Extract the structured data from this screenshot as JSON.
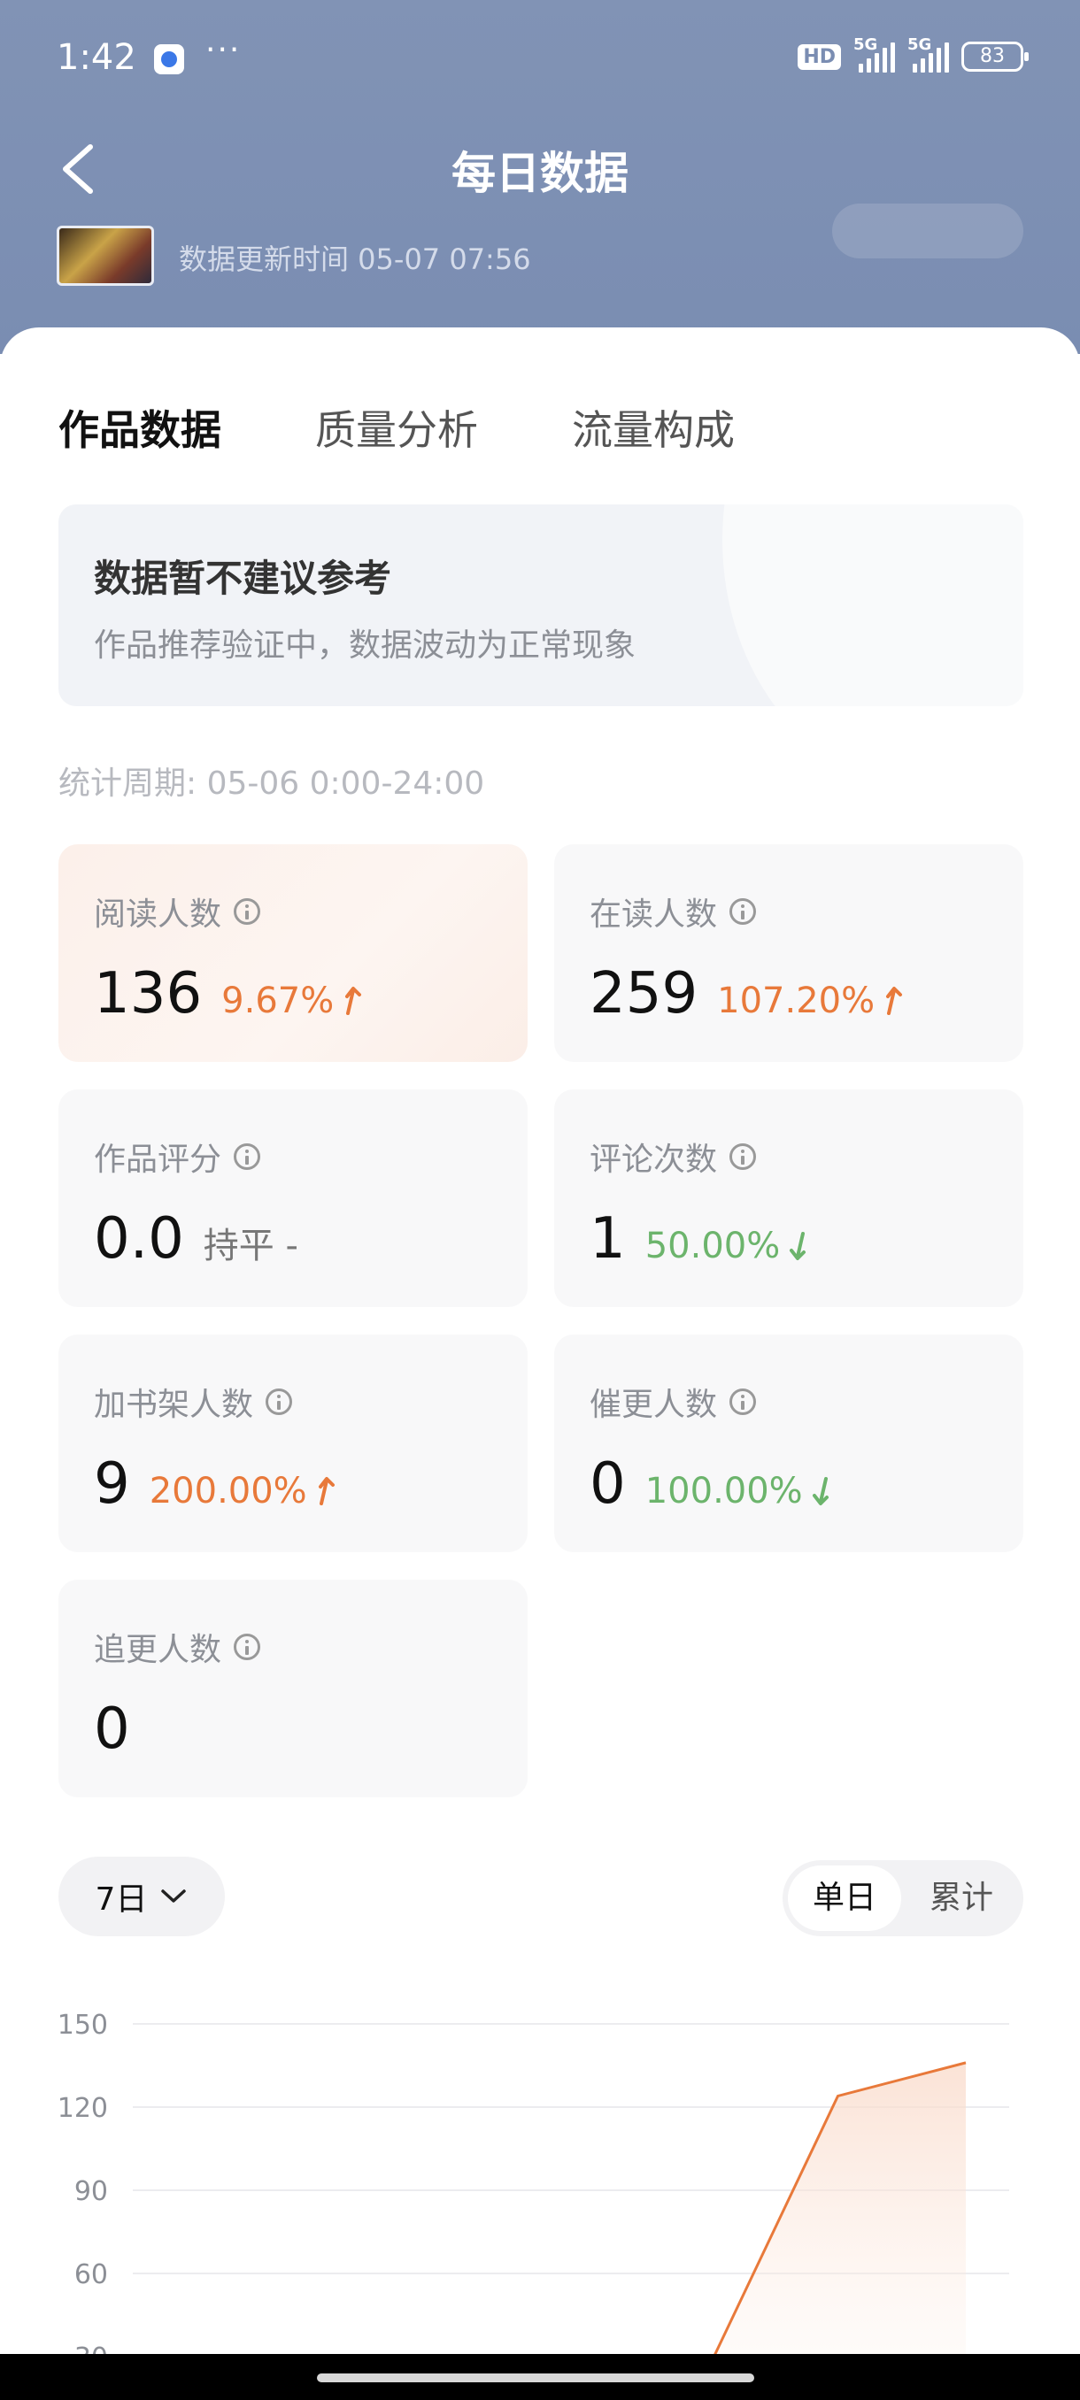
{
  "status_bar": {
    "time": "1:42",
    "dots": "···",
    "hd": "HD",
    "signal_label_1": "5G",
    "signal_label_2": "5G",
    "battery": "83"
  },
  "header": {
    "title": "每日数据",
    "update_time": "数据更新时间 05-07 07:56"
  },
  "tabs": [
    {
      "label": "作品数据",
      "active": true
    },
    {
      "label": "质量分析",
      "active": false
    },
    {
      "label": "流量构成",
      "active": false
    }
  ],
  "notice": {
    "title": "数据暂不建议参考",
    "desc": "作品推荐验证中，数据波动为正常现象"
  },
  "period": "统计周期: 05-06 0:00-24:00",
  "metrics": [
    {
      "label": "阅读人数",
      "value": "136",
      "change": "9.67%",
      "trend": "up"
    },
    {
      "label": "在读人数",
      "value": "259",
      "change": "107.20%",
      "trend": "up"
    },
    {
      "label": "作品评分",
      "value": "0.0",
      "change": "持平 -",
      "trend": "flat"
    },
    {
      "label": "评论次数",
      "value": "1",
      "change": "50.00%",
      "trend": "down"
    },
    {
      "label": "加书架人数",
      "value": "9",
      "change": "200.00%",
      "trend": "up"
    },
    {
      "label": "催更人数",
      "value": "0",
      "change": "100.00%",
      "trend": "down"
    },
    {
      "label": "追更人数",
      "value": "0",
      "change": "",
      "trend": "none"
    }
  ],
  "controls": {
    "range": "7日",
    "seg_single": "单日",
    "seg_cumulative": "累计"
  },
  "colors": {
    "accent": "#e8793a",
    "up": "#e8793a",
    "down": "#6cb46c",
    "header_bg": "#7a8db2"
  },
  "chart_data": {
    "type": "line",
    "y_ticks": [
      "150",
      "120",
      "90",
      "60",
      "30"
    ],
    "ylim": [
      30,
      150
    ],
    "x": [
      1,
      2,
      3,
      4,
      5,
      6,
      7
    ],
    "values": [
      null,
      null,
      null,
      null,
      27,
      124,
      136
    ],
    "note_visible_portion": "x axis labels not visible in screenshot"
  }
}
